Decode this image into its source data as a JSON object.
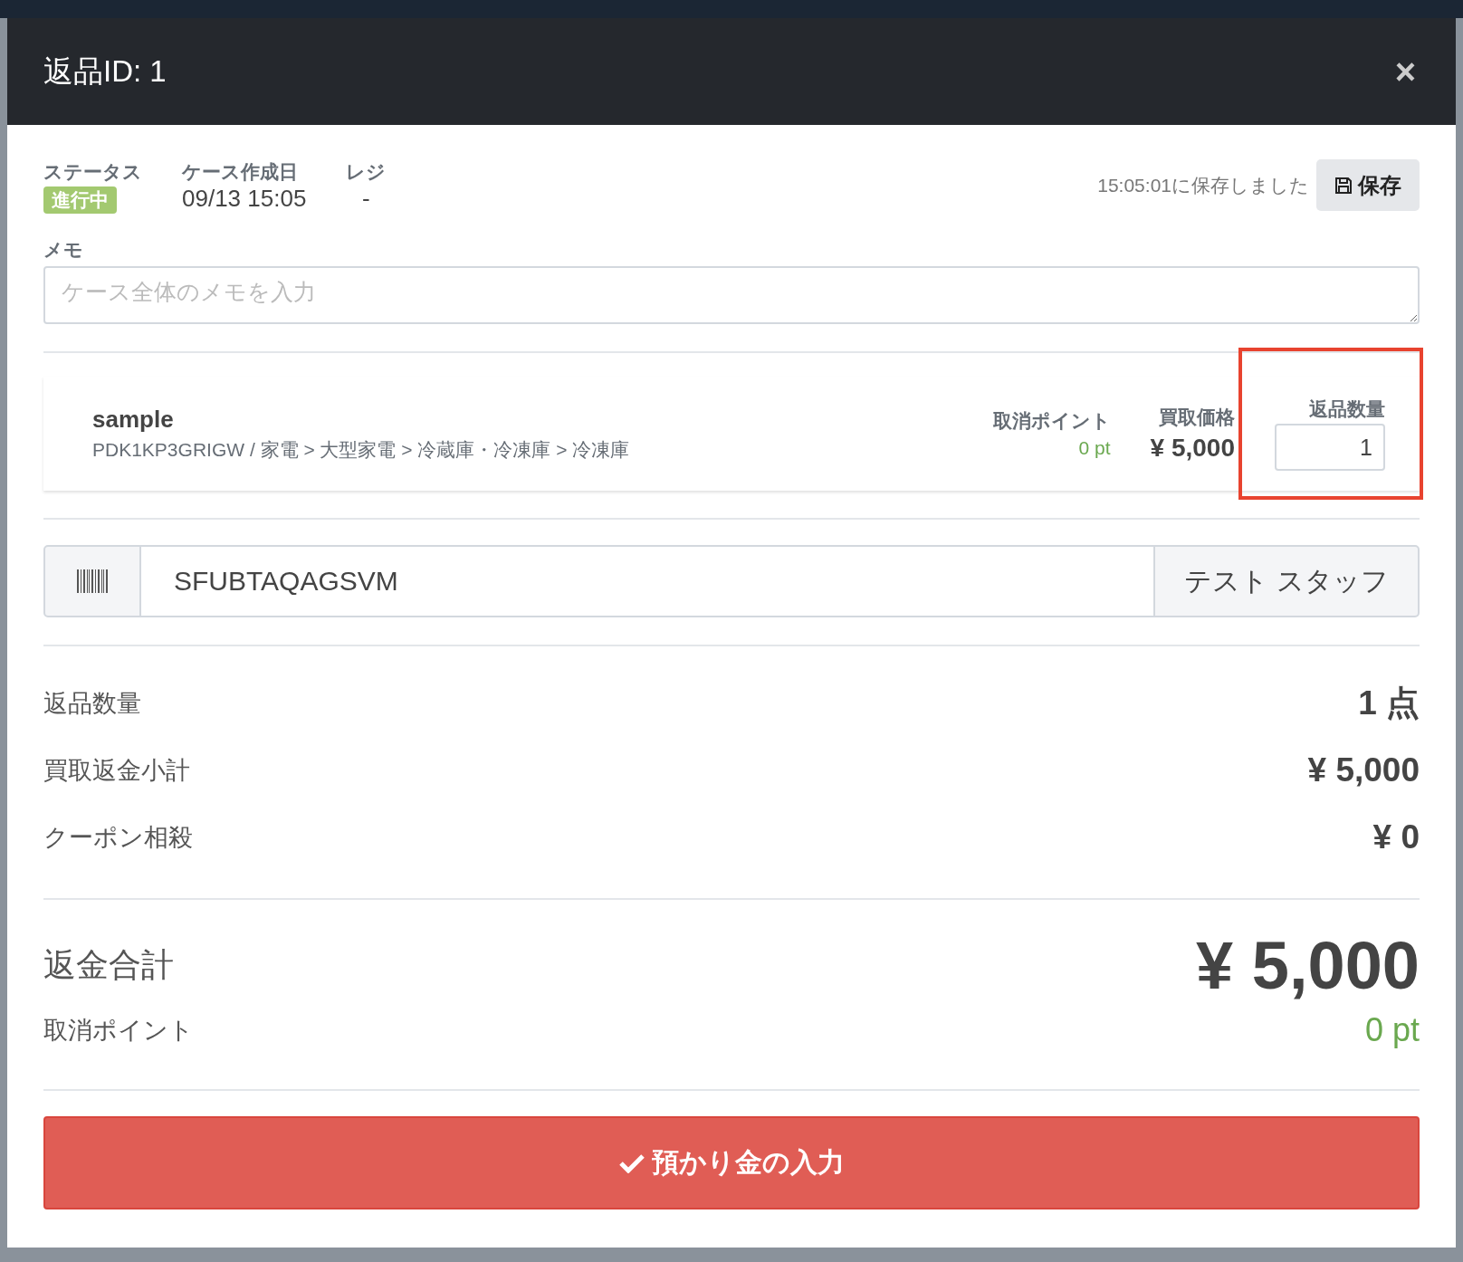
{
  "modal": {
    "title": "返品ID: 1",
    "close": "×"
  },
  "info": [
    {
      "label": "ステータス",
      "kind": "badge",
      "value": "進行中",
      "color": "#a3c970"
    },
    {
      "label": "ケース作成日",
      "kind": "text",
      "value": "09/13 15:05"
    },
    {
      "label": "レジ",
      "kind": "text",
      "value": "-"
    }
  ],
  "save": {
    "message": "15:05:01に保存しました",
    "button": "保存"
  },
  "memo": {
    "label": "メモ",
    "placeholder": "ケース全体のメモを入力"
  },
  "item": {
    "name": "sample",
    "path": "PDK1KP3GRIGW / 家電 > 大型家電 > 冷蔵庫・冷凍庫 > 冷凍庫",
    "points_label": "取消ポイント",
    "points": "0 pt",
    "price_label": "買取価格",
    "price": "¥ 5,000",
    "quantity_label": "返品数量",
    "quantity": "1",
    "quantity_highlighted": true
  },
  "scan": {
    "value": "SFUBTAQAGSVM",
    "staff": "テスト スタッフ"
  },
  "summary": [
    {
      "label": "返品数量",
      "value": "1 点"
    },
    {
      "label": "買取返金小計",
      "value": "¥ 5,000"
    },
    {
      "label": "クーポン相殺",
      "value": "¥ 0"
    }
  ],
  "total": {
    "label": "返金合計",
    "value": "¥ 5,000",
    "points_label": "取消ポイント",
    "points": "0 pt"
  },
  "submit": "預かり金の入力"
}
